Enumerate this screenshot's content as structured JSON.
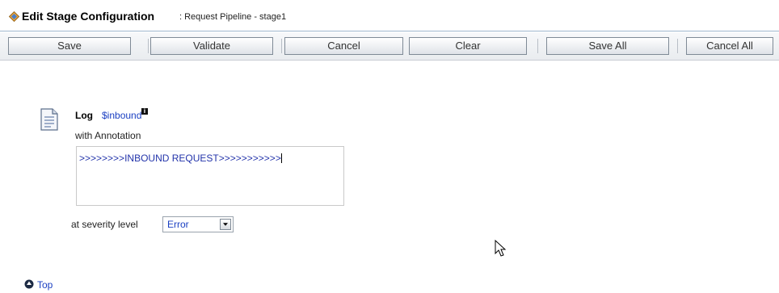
{
  "header": {
    "title": "Edit Stage Configuration",
    "subtitle": ": Request Pipeline - stage1"
  },
  "toolbar": {
    "save_label": "Save",
    "validate_label": "Validate",
    "cancel_label": "Cancel",
    "clear_label": "Clear",
    "save_all_label": "Save All",
    "cancel_all_label": "Cancel All"
  },
  "action": {
    "name": "Log",
    "variable": "$inbound",
    "info_badge": "i",
    "annotation_label": "with Annotation",
    "annotation_value": ">>>>>>>>INBOUND REQUEST>>>>>>>>>>>",
    "severity_label": "at severity level",
    "severity_value": "Error"
  },
  "footer": {
    "top_link": "Top"
  },
  "icons": {
    "title": "stage-config-icon",
    "action": "document-icon",
    "select": "chevron-down-icon",
    "cursor": "mouse-pointer-icon",
    "top": "arrow-up-circle-icon"
  },
  "colors": {
    "link": "#1a3fc2",
    "toolbar_bg": "#e9ecef"
  }
}
